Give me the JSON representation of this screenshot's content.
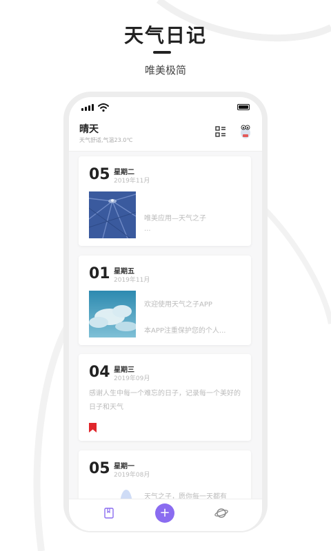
{
  "promo": {
    "title": "天气日记",
    "subtitle": "唯美极简"
  },
  "header": {
    "weather": "晴天",
    "detail": "天气舒适,气温23.0℃",
    "icons": [
      "grid-list-icon",
      "avatar-mascot-icon"
    ]
  },
  "status_bar": {
    "icons": [
      "cellular-signal-icon",
      "wifi-icon",
      "battery-icon"
    ]
  },
  "entries": [
    {
      "day": "05",
      "weekday": "星期二",
      "year_month": "2019年11月",
      "image": "umbrella-photo",
      "lines": [
        "唯美应用—天气之子",
        "..."
      ]
    },
    {
      "day": "01",
      "weekday": "星期五",
      "year_month": "2019年11月",
      "image": "sky-clouds-photo",
      "lines": [
        "欢迎使用天气之子APP",
        "本APP注重保护您的个人..."
      ]
    },
    {
      "day": "04",
      "weekday": "星期三",
      "year_month": "2019年09月",
      "text": "感谢人生中每一个难忘的日子，记录每一个美好的日子和天气",
      "marker": "bookmark-icon"
    },
    {
      "day": "05",
      "weekday": "星期一",
      "year_month": "2019年08月",
      "image": "cartoon-ghost-image",
      "lines": [
        "天气之子，愿你每一天都有"
      ]
    }
  ],
  "bottom_nav": {
    "add_symbol": "+",
    "icons": [
      "diary-book-icon",
      "add-icon",
      "planet-icon"
    ],
    "accent": "#8a6cf0"
  },
  "colors": {
    "bookmark": "#e0262b",
    "muted_text": "#bbbbbb"
  }
}
